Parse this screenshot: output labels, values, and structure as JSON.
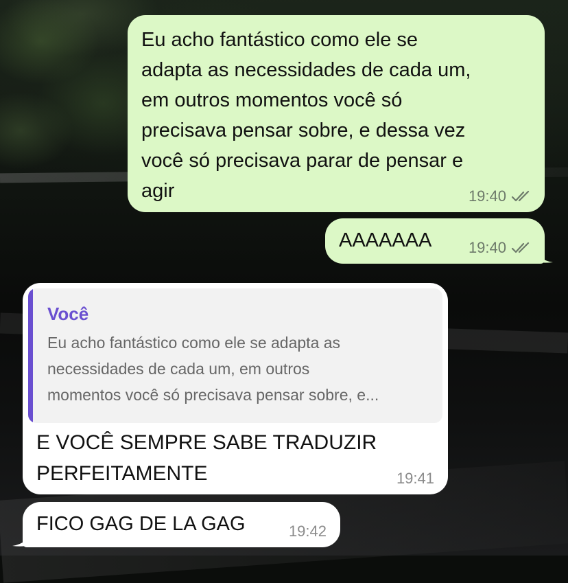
{
  "messages": [
    {
      "id": "m1",
      "direction": "outgoing",
      "lines": [
        "Eu acho fantástico como ele se",
        "adapta as necessidades de cada um,",
        "em outros momentos você só",
        "precisava pensar sobre, e dessa vez",
        "você só precisava parar de pensar e",
        "agir"
      ],
      "time": "19:40",
      "status": "read-double-check"
    },
    {
      "id": "m2",
      "direction": "outgoing",
      "text": "AAAAAAA",
      "time": "19:40",
      "status": "read-double-check"
    },
    {
      "id": "m3",
      "direction": "incoming",
      "quote": {
        "author": "Você",
        "lines": [
          "Eu acho fantástico como ele se adapta as",
          "necessidades de cada um, em outros",
          "momentos você só precisava pensar sobre, e..."
        ]
      },
      "lines": [
        "E VOCÊ SEMPRE SABE TRADUZIR",
        "PERFEITAMENTE"
      ],
      "time": "19:41"
    },
    {
      "id": "m4",
      "direction": "incoming",
      "text": "FICO GAG DE LA GAG",
      "time": "19:42"
    }
  ],
  "colors": {
    "outgoing_bubble": "#dcf8c6",
    "incoming_bubble": "#ffffff",
    "quote_accent": "#6a4fd0",
    "quote_bg": "#f2f2f2"
  }
}
